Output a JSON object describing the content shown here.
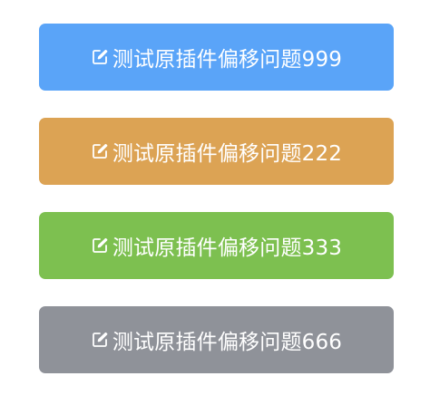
{
  "buttons": [
    {
      "label": "测试原插件偏移问题999",
      "color": "#5aa4f8",
      "icon": "edit-icon"
    },
    {
      "label": "测试原插件偏移问题222",
      "color": "#dca354",
      "icon": "edit-icon"
    },
    {
      "label": "测试原插件偏移问题333",
      "color": "#7dc050",
      "icon": "edit-icon"
    },
    {
      "label": "测试原插件偏移问题666",
      "color": "#8f9299",
      "icon": "edit-icon"
    }
  ]
}
